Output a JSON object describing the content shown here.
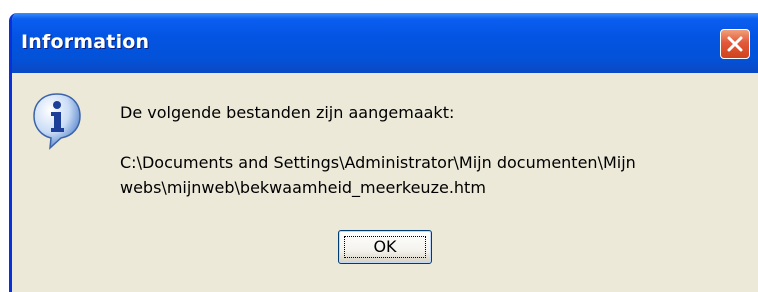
{
  "dialog": {
    "title": "Information",
    "icon": "information-icon",
    "close_icon": "close-icon",
    "message_line1": "De volgende bestanden zijn aangemaakt:",
    "path_line1": "C:\\Documents and Settings\\Administrator\\Mijn documenten\\Mijn",
    "path_line2": "webs\\mijnweb\\bekwaamheid_meerkeuze.htm",
    "ok_label": "OK"
  },
  "colors": {
    "titlebar": "#0454e3",
    "window_background": "#ece9d8",
    "close_button": "#e2593a",
    "title_text": "#ffffff"
  }
}
